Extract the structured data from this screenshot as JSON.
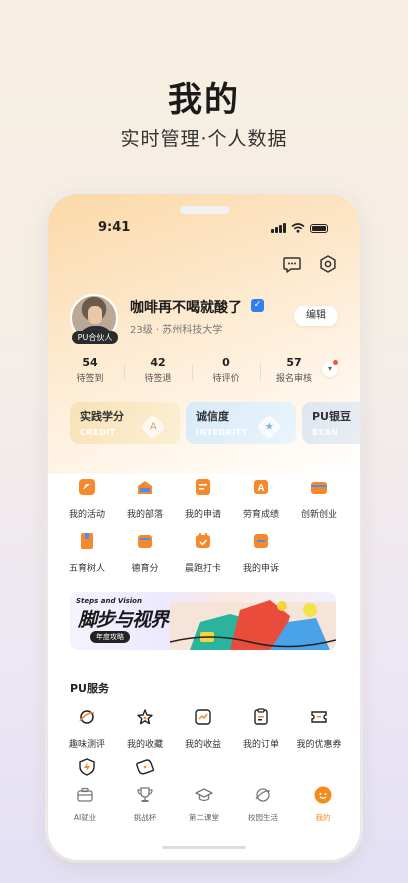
{
  "promo": {
    "title": "我的",
    "subtitle": "实时管理·个人数据"
  },
  "status_bar": {
    "time": "9:41"
  },
  "header": {
    "message_icon": "message-icon",
    "settings_icon": "settings-icon"
  },
  "profile": {
    "badge": "PU合伙人",
    "name": "咖啡再不喝就酸了",
    "verified_mark": "✓",
    "school": "23级 · 苏州科技大学",
    "edit_label": "编辑"
  },
  "stats": [
    {
      "value": "54",
      "label": "待签到"
    },
    {
      "value": "42",
      "label": "待签退"
    },
    {
      "value": "0",
      "label": "待评价"
    },
    {
      "value": "57",
      "label": "报名审核"
    }
  ],
  "stats_more": "▾",
  "cards": [
    {
      "title": "实践学分",
      "en": "CREDIT",
      "icon": "A"
    },
    {
      "title": "诚信度",
      "en": "INTEGRITY",
      "icon": "★"
    },
    {
      "title": "PU银豆",
      "en": "BEAN",
      "icon": ""
    }
  ],
  "feature_grid": [
    {
      "label": "我的活动",
      "icon": "flag-icon"
    },
    {
      "label": "我的部落",
      "icon": "tribe-icon"
    },
    {
      "label": "我的申请",
      "icon": "application-icon"
    },
    {
      "label": "劳育成绩",
      "icon": "grade-icon"
    },
    {
      "label": "创新创业",
      "icon": "briefcase-icon"
    },
    {
      "label": "五育树人",
      "icon": "book-icon"
    },
    {
      "label": "德育分",
      "icon": "morality-icon"
    },
    {
      "label": "晨跑打卡",
      "icon": "calendar-check-icon"
    },
    {
      "label": "我的申诉",
      "icon": "appeal-icon"
    }
  ],
  "banner": {
    "en": "Steps and Vision",
    "cn": "脚步与视界",
    "tag": "年度攻略"
  },
  "services": {
    "title": "PU服务",
    "items": [
      {
        "label": "趣味测评",
        "icon": "planet-icon"
      },
      {
        "label": "我的收藏",
        "icon": "star-icon"
      },
      {
        "label": "我的收益",
        "icon": "chart-icon"
      },
      {
        "label": "我的订单",
        "icon": "order-icon"
      },
      {
        "label": "我的优惠券",
        "icon": "coupon-icon"
      },
      {
        "label": "",
        "icon": "lightning-icon"
      },
      {
        "label": "",
        "icon": "chat-bubble-icon"
      }
    ]
  },
  "tabbar": [
    {
      "label": "AI就业",
      "icon": "briefcase-icon"
    },
    {
      "label": "挑战杯",
      "icon": "trophy-icon"
    },
    {
      "label": "第二课堂",
      "icon": "graduation-cap-icon"
    },
    {
      "label": "校园生活",
      "icon": "planet-icon"
    },
    {
      "label": "我的",
      "icon": "profile-icon",
      "active": true
    }
  ],
  "colors": {
    "accent": "#f58a1f",
    "grid_icon_orange": "#f5892b",
    "grid_icon_blue": "#4a8ff0"
  }
}
